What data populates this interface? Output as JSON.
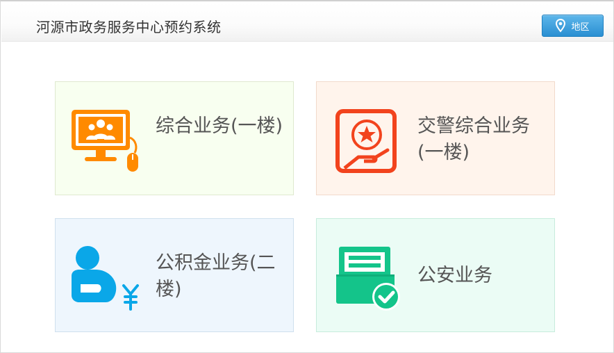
{
  "header": {
    "title": "河源市政务服务中心预约系统",
    "region_button": "地区"
  },
  "cards": [
    {
      "label": "综合业务(一楼)",
      "icon": "monitor-people-icon",
      "color": "#ff8a00"
    },
    {
      "label": "交警综合业务(一楼)",
      "icon": "traffic-police-badge-icon",
      "color": "#f2431d"
    },
    {
      "label": "公积金业务(二楼)",
      "icon": "person-yuan-icon",
      "color": "#0aa7e8"
    },
    {
      "label": "公安业务",
      "icon": "approved-document-icon",
      "color": "#14c48a"
    }
  ]
}
